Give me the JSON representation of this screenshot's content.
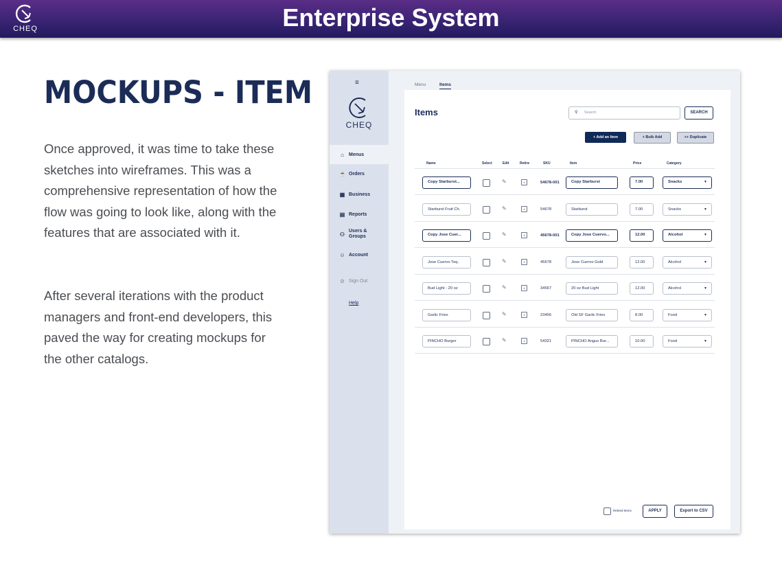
{
  "banner": {
    "title": "Enterprise System",
    "logo_text": "CHEQ"
  },
  "page": {
    "heading": "MOCKUPS - ITEM",
    "paragraph1": "Once approved, it was time to take these sketches into wireframes. This was a comprehensive representation of how the flow was going to look like, along with the features that are associated with it.",
    "paragraph2": "After several iterations with the product managers and front-end developers, this paved the way for creating mockups for the other catalogs."
  },
  "mockup": {
    "sidebar": {
      "menu_toggle": "≡",
      "logo_text": "CHEQ",
      "items": [
        {
          "label": "Menus",
          "icon": "storefront-icon",
          "active": true
        },
        {
          "label": "Orders",
          "icon": "cup-icon"
        },
        {
          "label": "Business",
          "icon": "building-icon"
        },
        {
          "label": "Reports",
          "icon": "report-icon"
        },
        {
          "label": "Users & Groups",
          "icon": "users-icon"
        },
        {
          "label": "Account",
          "icon": "account-icon"
        }
      ],
      "sign_out": "Sign Out",
      "help": "Help"
    },
    "tabs": [
      "Menu",
      "Items"
    ],
    "active_tab": "Items",
    "title": "Items",
    "search": {
      "placeholder": "Search",
      "button": "SEARCH"
    },
    "actions": {
      "add": "+ Add an Item",
      "bulk": "+ Bulk Add",
      "duplicate": "++ Duplicate"
    },
    "table": {
      "headers": [
        "Name",
        "Select",
        "Edit",
        "Retire",
        "SKU",
        "Item",
        "Price",
        "Category"
      ],
      "rows": [
        {
          "name": "Copy Starburst...",
          "sku": "54678-001",
          "item": "Copy Starburst",
          "price": "7.00",
          "category": "Snacks",
          "highlight": true
        },
        {
          "name": "Starburst Fruit Ch.",
          "sku": "54678",
          "item": "Starburst",
          "price": "7.00",
          "category": "Snacks",
          "highlight": false
        },
        {
          "name": "Copy Jose Cuer...",
          "sku": "45678-001",
          "item": "Copy Jose Cuervo...",
          "price": "12.00",
          "category": "Alcohol",
          "highlight": true
        },
        {
          "name": "Jose Cuervo Teq..",
          "sku": "45678",
          "item": "Jose Cuervo Gold",
          "price": "12.00",
          "category": "Alcohol",
          "highlight": false
        },
        {
          "name": "Bud Light - 20 oz",
          "sku": "34567",
          "item": "20 oz Bud Light",
          "price": "12.00",
          "category": "Alcohol",
          "highlight": false
        },
        {
          "name": "Garlic Fries",
          "sku": "23456",
          "item": "Old SF Garlic Fries",
          "price": "8.00",
          "category": "Food",
          "highlight": false
        },
        {
          "name": "PINCHO Burger",
          "sku": "54321",
          "item": "PINCHO Angus Bur...",
          "price": "10.00",
          "category": "Food",
          "highlight": false
        }
      ]
    },
    "footer": {
      "retired_label": "Retired Items",
      "apply": "APPLY",
      "export": "Export to CSV"
    }
  }
}
